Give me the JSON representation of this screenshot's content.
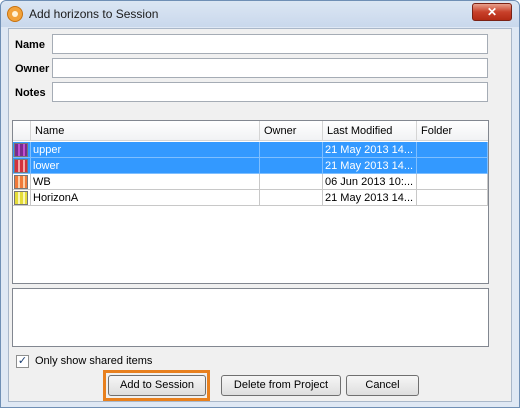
{
  "window": {
    "title": "Add horizons to Session",
    "close_label": "✕"
  },
  "form": {
    "name_label": "Name",
    "name_value": "",
    "owner_label": "Owner",
    "owner_value": "",
    "notes_label": "Notes",
    "notes_value": ""
  },
  "table": {
    "columns": [
      "Name",
      "Owner",
      "Last Modified",
      "Folder"
    ],
    "rows": [
      {
        "name": "upper",
        "owner": "",
        "modified": "21 May 2013 14...",
        "folder": "",
        "selected": true
      },
      {
        "name": "lower",
        "owner": "",
        "modified": "21 May 2013 14...",
        "folder": "",
        "selected": true
      },
      {
        "name": "WB",
        "owner": "",
        "modified": "06 Jun 2013 10:...",
        "folder": "",
        "selected": false
      },
      {
        "name": "HorizonA",
        "owner": "",
        "modified": "21 May 2013 14...",
        "folder": "",
        "selected": false
      }
    ]
  },
  "shared_only": {
    "label": "Only show shared items",
    "checked": true,
    "mark": "✓"
  },
  "buttons": {
    "add": "Add to Session",
    "delete": "Delete from Project",
    "cancel": "Cancel"
  },
  "colors": {
    "selection": "#3399ff",
    "highlight": "#e8801e"
  },
  "icons": [
    "horizon-grid-icon-purple",
    "horizon-grid-icon-red",
    "horizon-grid-icon-orange",
    "horizon-grid-icon-yellow"
  ]
}
